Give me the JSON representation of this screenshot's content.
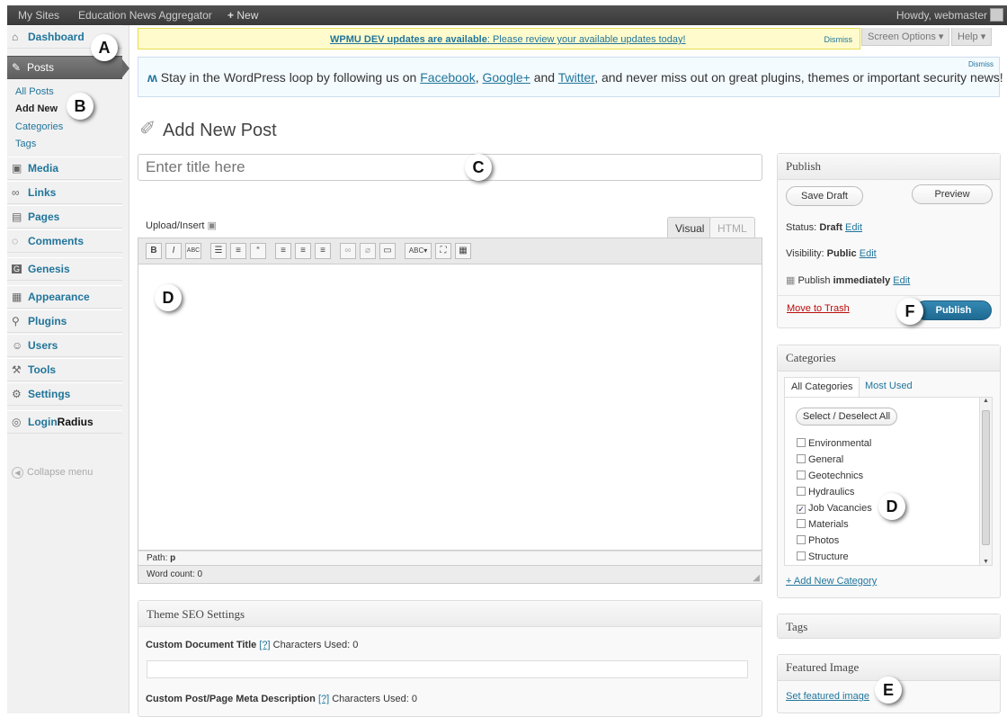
{
  "adminbar": {
    "my_sites": "My Sites",
    "site_name": "Education News Aggregator",
    "new_label": "New",
    "new_icon": "+",
    "howdy": "Howdy, webmaster"
  },
  "sidebar": {
    "dashboard": "Dashboard",
    "posts": "Posts",
    "sub": [
      "All Posts",
      "Add New",
      "Categories",
      "Tags"
    ],
    "media": "Media",
    "links": "Links",
    "pages": "Pages",
    "comments": "Comments",
    "genesis": "Genesis",
    "appearance": "Appearance",
    "plugins": "Plugins",
    "users": "Users",
    "tools": "Tools",
    "settings": "Settings",
    "loginradius_a": "Login",
    "loginradius_b": "Radius",
    "collapse": "Collapse menu"
  },
  "nag": {
    "bold": "WPMU DEV updates are available",
    "rest": ": Please review your available updates today!",
    "dismiss": "Dismiss"
  },
  "screen_options": "Screen Options",
  "help": "Help",
  "notice": {
    "lead": "Stay in the WordPress loop by following us on ",
    "facebook": "Facebook",
    "comma": ", ",
    "google": "Google+",
    "and": " and ",
    "twitter": "Twitter",
    "tail": ", and never miss out on great plugins, themes or important security news!",
    "dismiss": "Dismiss"
  },
  "page_title": "Add New Post",
  "title_placeholder": "Enter title here",
  "editor": {
    "upload_insert": "Upload/Insert",
    "tab_visual": "Visual",
    "tab_html": "HTML",
    "path_label": "Path:",
    "path_value": "p",
    "word_count": "Word count: 0"
  },
  "seo": {
    "title": "Theme SEO Settings",
    "doc_title_label": "Custom Document Title",
    "q": "[?]",
    "chars_used": "Characters Used: 0",
    "meta_desc_label": "Custom Post/Page Meta Description"
  },
  "publish": {
    "title": "Publish",
    "save_draft": "Save Draft",
    "preview": "Preview",
    "status_label": "Status:",
    "status_value": "Draft",
    "visibility_label": "Visibility:",
    "visibility_value": "Public",
    "publish_label": "Publish",
    "publish_value": "immediately",
    "edit": "Edit",
    "move_to_trash": "Move to Trash",
    "publish_button": "Publish"
  },
  "categories": {
    "title": "Categories",
    "tab_all": "All Categories",
    "tab_used": "Most Used",
    "select_all": "Select / Deselect All",
    "items": [
      {
        "label": "Environmental",
        "checked": false
      },
      {
        "label": "General",
        "checked": false
      },
      {
        "label": "Geotechnics",
        "checked": false
      },
      {
        "label": "Hydraulics",
        "checked": false
      },
      {
        "label": "Job Vacancies",
        "checked": true
      },
      {
        "label": "Materials",
        "checked": false
      },
      {
        "label": "Photos",
        "checked": false
      },
      {
        "label": "Structure",
        "checked": false
      }
    ],
    "add_new": "+ Add New Category"
  },
  "tags": {
    "title": "Tags"
  },
  "featured": {
    "title": "Featured Image",
    "set": "Set featured image"
  },
  "callouts": {
    "a": "A",
    "b": "B",
    "c": "C",
    "d1": "D",
    "d2": "D",
    "e": "E",
    "f": "F"
  },
  "colors": {
    "link": "#21759b",
    "publish": "#2a7aa6",
    "trash": "#bc0b0b",
    "nag_bg": "#fffbcc"
  }
}
